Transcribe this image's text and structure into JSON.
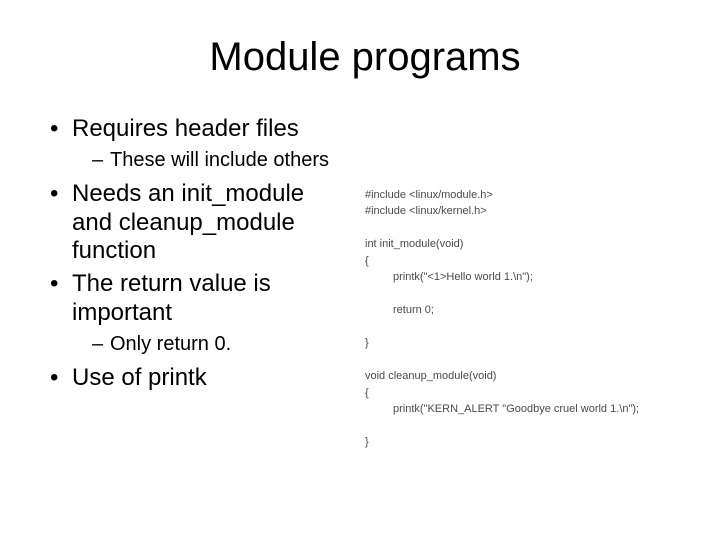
{
  "title": "Module programs",
  "bullets": {
    "b1": "Requires header files",
    "b1_sub1": "These will include others",
    "b2": "Needs an init_module and cleanup_module function",
    "b3": "The return value is important",
    "b3_sub1": "Only return 0.",
    "b4": "Use of printk"
  },
  "code": {
    "line1": "#include <linux/module.h>",
    "line2": "#include <linux/kernel.h>",
    "line3": "int init_module(void)",
    "line4": "{",
    "line5": "printk(\"<1>Hello world 1.\\n\");",
    "line6": "return 0;",
    "line7": "}",
    "line8": "void cleanup_module(void)",
    "line9": "{",
    "line10": "printk(\"KERN_ALERT \"Goodbye cruel world 1.\\n\");",
    "line11": "}"
  }
}
